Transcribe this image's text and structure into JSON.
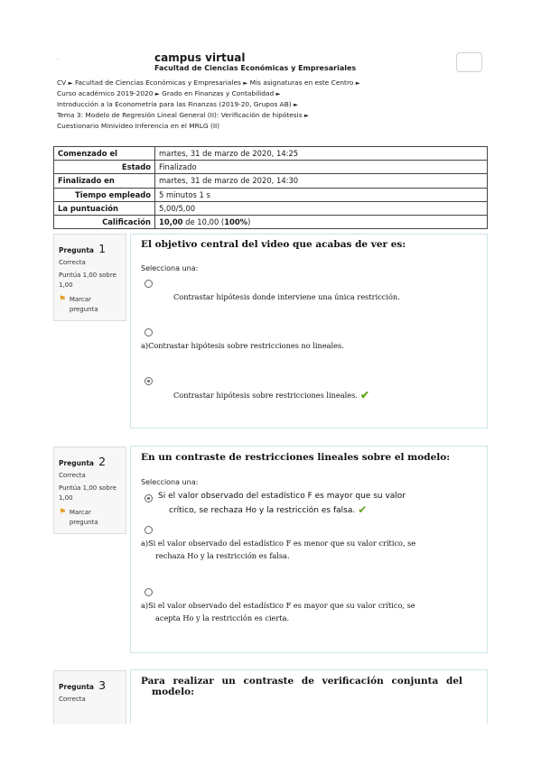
{
  "header": {
    "dot": ".",
    "site_title": "campus virtual",
    "site_subtitle": "Facultad de Ciencias Económicas y Empresariales",
    "menu_icon": "menu-button"
  },
  "breadcrumb": {
    "separator": "►",
    "items": [
      "CV",
      "Facultad de Ciencias Económicas y Empresariales",
      "Mis asignaturas en este Centro",
      "Curso académico 2019-2020",
      "Grado en Finanzas y Contabilidad",
      "Introducción a la Econometría para las Finanzas (2019-20, Grupos AB)",
      "Tema 3: Modelo de Regresión Lineal General (II): Verificación de hipótesis",
      "Cuestionario Minivideo Inferencia en el MRLG (II)"
    ]
  },
  "summary": {
    "rows": [
      {
        "label": "Comenzado el",
        "value": "martes, 31 de marzo de 2020, 14:25"
      },
      {
        "label": "Estado",
        "value": "Finalizado"
      },
      {
        "label": "Finalizado en",
        "value": "martes, 31 de marzo de 2020, 14:30"
      },
      {
        "label": "Tiempo empleado",
        "value": "5 minutos 1 s"
      },
      {
        "label": "La puntuación",
        "value": "5,00/5,00"
      },
      {
        "label": "Calificación",
        "value_bold": "10,00",
        "value_mid": " de 10,00 (",
        "value_pct": "100%",
        "value_end": ")"
      }
    ]
  },
  "questions": [
    {
      "word": "Pregunta",
      "number": "1",
      "state": "Correcta",
      "mark": "Puntúa 1,00 sobre 1,00",
      "flag_label": "Marcar pregunta",
      "text": "El objetivo central del video que acabas de ver es:",
      "select_label": "Selecciona una:",
      "answers": [
        {
          "text": "Contrastar hipótesis donde interviene una única restricción.",
          "checked": false
        },
        {
          "text": "a)Contrastar hipótesis sobre restricciones no lineales.",
          "checked": false
        },
        {
          "text": "Contrastar hipótesis sobre restricciones lineales.",
          "checked": true
        }
      ]
    },
    {
      "word": "Pregunta",
      "number": "2",
      "state": "Correcta",
      "mark": "Puntúa 1,00 sobre 1,00",
      "flag_label": "Marcar pregunta",
      "text": "En un contraste de restricciones lineales sobre el modelo:",
      "select_label": "Selecciona una:",
      "answers": [
        {
          "line1": "Si el valor observado del estadístico F es mayor que su valor",
          "line2": "crítico, se rechaza Ho y la restricción es falsa.",
          "checked": true
        },
        {
          "line1": "a)Si el valor observado del estadístico F es menor que su valor crítico, se",
          "line2": "rechaza Ho y la restricción es falsa.",
          "checked": false
        },
        {
          "line1": "a)Si el valor observado del estadístico F es mayor que su valor crítico, se",
          "line2": "acepta Ho y la restricción es cierta.",
          "checked": false
        }
      ]
    },
    {
      "word": "Pregunta",
      "number": "3",
      "state": "Correcta",
      "line1": "Para realizar un contraste de verificación conjunta del",
      "line2": "modelo:"
    }
  ],
  "colors": {
    "check": "#5fa51e",
    "flag": "#e29b1a",
    "box_border": "#cfe6ea"
  }
}
